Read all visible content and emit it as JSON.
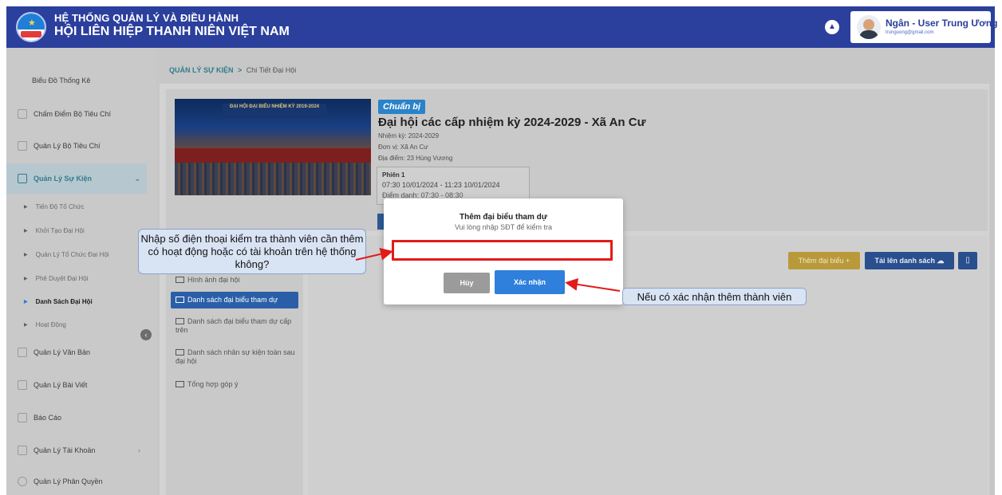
{
  "header": {
    "title_line1": "HỆ THỐNG QUẢN LÝ VÀ ĐIỀU HÀNH",
    "title_line2": "HỘI LIÊN HIỆP THANH NIÊN VIỆT NAM",
    "user_name": "Ngân - User Trung Ương",
    "user_email": "trunguong@gmail.com",
    "icons": [
      "logo",
      "bell-icon",
      "avatar"
    ]
  },
  "sidebar": {
    "items": [
      {
        "label": "Biểu Đồ Thống Kê"
      },
      {
        "label": "Chấm Điểm Bộ Tiêu Chí"
      },
      {
        "label": "Quản Lý Bộ Tiêu Chí"
      },
      {
        "label": "Quản Lý Sự Kiện"
      },
      {
        "label": "Quản Lý Văn Bản"
      },
      {
        "label": "Quản Lý Bài Viết"
      },
      {
        "label": "Báo Cáo"
      },
      {
        "label": "Quản Lý Tài Khoản"
      },
      {
        "label": "Quản Lý Phân Quyền"
      }
    ],
    "sub_items": [
      {
        "label": "Tiến Độ Tổ Chức"
      },
      {
        "label": "Khởi Tạo Đại Hội"
      },
      {
        "label": "Quản Lý Tổ Chức Đại Hội"
      },
      {
        "label": "Phê Duyệt Đại Hội"
      },
      {
        "label": "Danh Sách Đại Hội"
      },
      {
        "label": "Hoạt Động"
      }
    ]
  },
  "breadcrumb": {
    "root": "QUẢN LÝ SỰ KIỆN",
    "separator": ">",
    "current": "Chi Tiết Đại Hội"
  },
  "event": {
    "image_banner": "ĐẠI HỘI ĐẠI BIỂU NHIỆM KỲ 2019-2024",
    "status_badge": "Chuẩn bị",
    "title": "Đại hội các cấp nhiệm kỳ 2024-2029 - Xã An Cư",
    "term": "Nhiệm kỳ: 2024-2029",
    "unit": "Đơn vị: Xã An Cư",
    "location": "Địa điểm: 23 Hùng Vương",
    "session_title": "Phiên 1",
    "session_time": "07:30 10/01/2024 - 11:23 10/01/2024",
    "session_place": "Điểm danh: 07:30 - 08:30"
  },
  "folders": [
    {
      "label": "Hình ảnh đại hội"
    },
    {
      "label": "Danh sách đại biểu tham dự"
    },
    {
      "label": "Danh sách đại biểu tham dự cấp trên"
    },
    {
      "label": "Danh sách nhân sự kiện toàn sau đại hội"
    },
    {
      "label": "Tổng hợp góp ý"
    }
  ],
  "actions": {
    "add_delegate": "Thêm đại biểu +",
    "upload_list": "Tải lên danh sách ☁",
    "doc_icon": "▯"
  },
  "modal": {
    "title": "Thêm đại biểu tham dự",
    "subtitle": "Vui lòng nhập SĐT để kiểm tra",
    "input_value": "",
    "cancel": "Hủy",
    "confirm": "Xác nhận"
  },
  "annotations": {
    "left": "Nhập số điện thoại kiểm tra thành viên cần thêm có hoạt động hoặc có tài khoản trên hệ thống không?",
    "right": "Nếu có xác nhận thêm thành viên"
  },
  "colors": {
    "header": "#2b3f9c",
    "confirm": "#2f7fdc",
    "highlight": "#e11b1b",
    "active_tab": "#2a5fa8"
  }
}
